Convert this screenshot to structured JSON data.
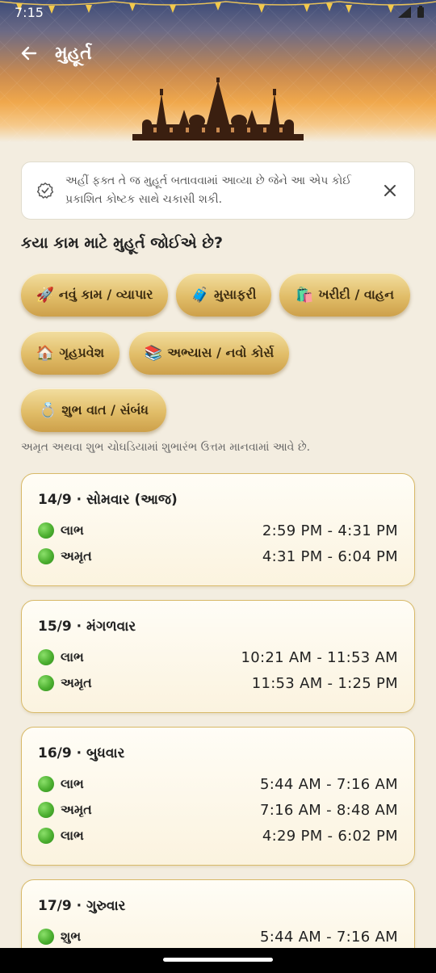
{
  "status": {
    "time": "7:15"
  },
  "appbar": {
    "title": "મુહૂર્ત"
  },
  "banner": {
    "text": "અહીં ફક્ત તે જ મુહૂર્ત બતાવવામાં આવ્યા છે જેને આ એપ કોઈ પ્રકાશિત કોષ્ટક સાથે ચકાસી શકી."
  },
  "question": "કયા કામ માટે મુહૂર્ત જોઈએ છે?",
  "chips": [
    {
      "emoji": "🚀",
      "label": "નવું કામ / વ્યાપાર"
    },
    {
      "emoji": "🧳",
      "label": "મુસાફરી"
    },
    {
      "emoji": "🛍️",
      "label": "ખરીદી / વાહન"
    },
    {
      "emoji": "🏠",
      "label": "ગૃહપ્રવેશ"
    },
    {
      "emoji": "📚",
      "label": "અભ્યાસ / નવો કોર્સ"
    },
    {
      "emoji": "💍",
      "label": "શુભ વાત / સંબંધ"
    }
  ],
  "hint": "અમૃત અથવા શુભ ચોઘડિયામાં શુભારંભ ઉત્તમ માનવામાં આવે છે.",
  "days": [
    {
      "title": "14/9 · સોમવાર (આજ)",
      "slots": [
        {
          "name": "લાભ",
          "time": "2:59 PM - 4:31 PM"
        },
        {
          "name": "અમૃત",
          "time": "4:31 PM - 6:04 PM"
        }
      ]
    },
    {
      "title": "15/9 · મંગળવાર",
      "slots": [
        {
          "name": "લાભ",
          "time": "10:21 AM - 11:53 AM"
        },
        {
          "name": "અમૃત",
          "time": "11:53 AM - 1:25 PM"
        }
      ]
    },
    {
      "title": "16/9 · બુધવાર",
      "slots": [
        {
          "name": "લાભ",
          "time": "5:44 AM - 7:16 AM"
        },
        {
          "name": "અમૃત",
          "time": "7:16 AM - 8:48 AM"
        },
        {
          "name": "લાભ",
          "time": "4:29 PM - 6:02 PM"
        }
      ]
    },
    {
      "title": "17/9 · ગુરુવાર",
      "slots": [
        {
          "name": "શુભ",
          "time": "5:44 AM - 7:16 AM"
        }
      ]
    }
  ],
  "colors": {
    "background": "#f3ede0",
    "chip_gold": "#e1bd68",
    "card_border": "#d8b968",
    "dot_green": "#4caf30"
  },
  "icons": {
    "back": "arrow-left-icon",
    "verify": "verified-check-icon",
    "close": "close-icon"
  }
}
